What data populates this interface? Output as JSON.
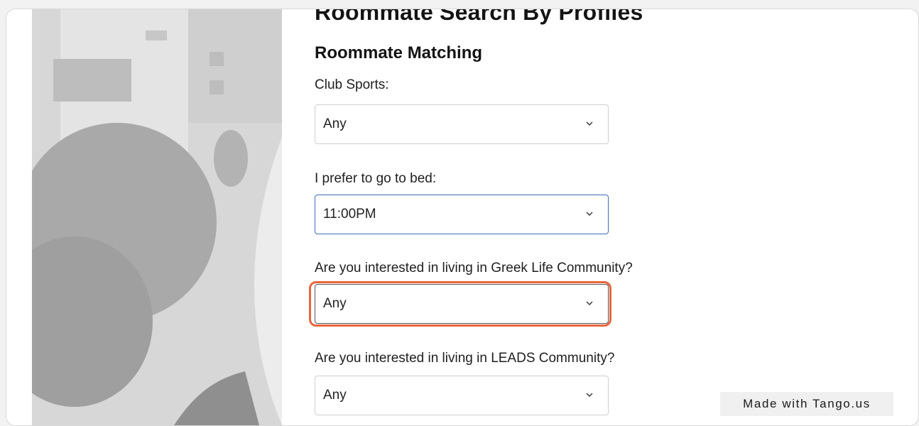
{
  "page": {
    "title": "Roommate Search By Profiles",
    "section_title": "Roommate Matching"
  },
  "fields": [
    {
      "label": "Club Sports:",
      "value": "Any"
    },
    {
      "label": "I prefer to go to bed:",
      "value": "11:00PM"
    },
    {
      "label": "Are you interested in living in Greek Life Community?",
      "value": "Any"
    },
    {
      "label": "Are you interested in living in LEADS Community?",
      "value": "Any"
    }
  ],
  "badge": {
    "text": "Made with Tango.us"
  },
  "colors": {
    "highlight_ring": "#e8663d",
    "focus_border": "#3b6fb6"
  }
}
